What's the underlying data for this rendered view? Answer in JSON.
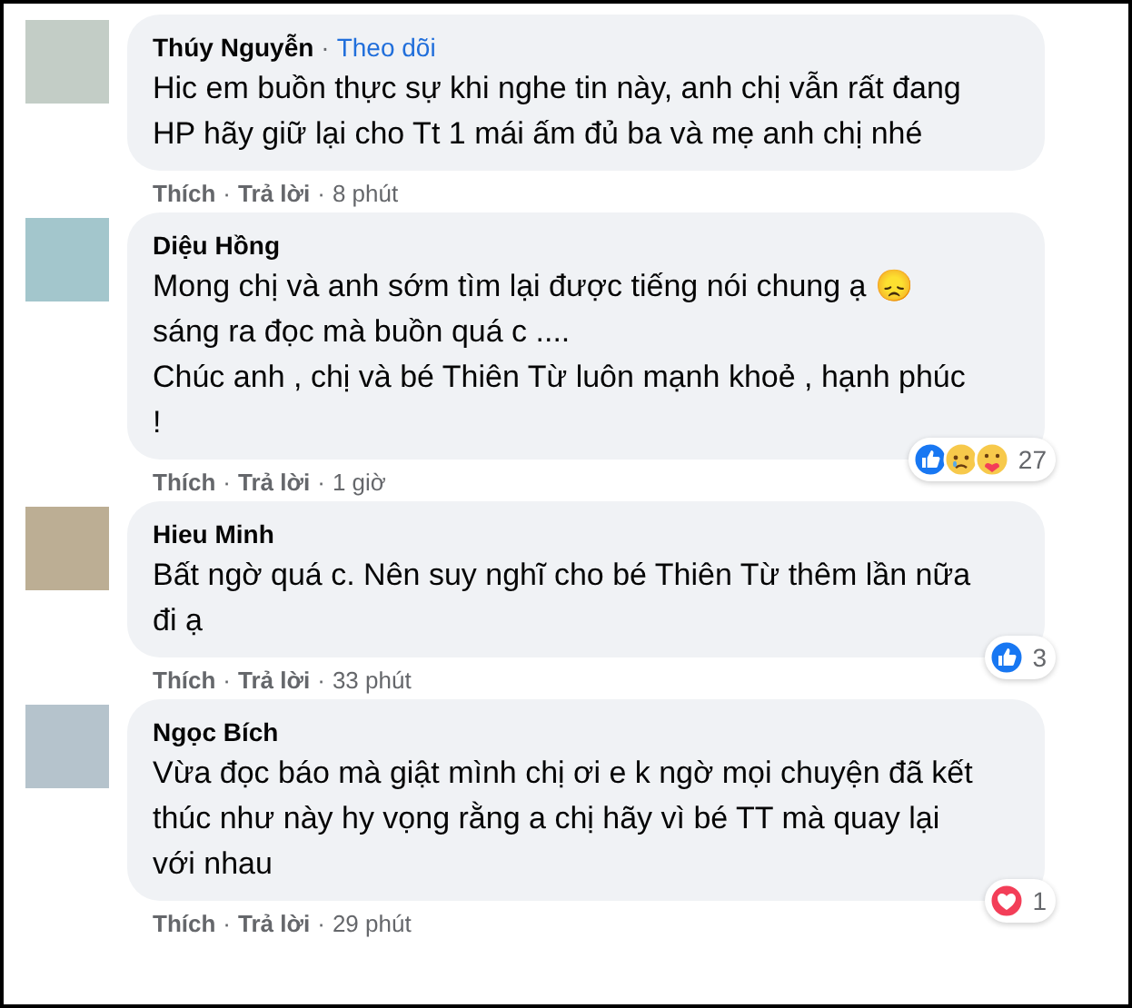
{
  "comments": [
    {
      "author": "Thúy Nguyễn",
      "separator": "·",
      "follow": "Theo dõi",
      "text": "Hic em buồn thực sự khi nghe tin này, anh chị vẫn rất đang HP hãy giữ lại cho Tt 1 mái ấm đủ ba và mẹ anh chị nhé",
      "actions": [
        "Thích",
        "Trả lời"
      ],
      "time": "8 phút"
    },
    {
      "author": "Diệu Hồng",
      "separator": "·",
      "text": "Mong chị và anh sớm tìm lại được tiếng nói chung ạ 😞\nsáng ra đọc mà buồn quá c ....\nChúc anh , chị và bé Thiên Từ luôn mạnh khoẻ , hạnh phúc !",
      "actions": [
        "Thích",
        "Trả lời"
      ],
      "time": "1 giờ",
      "reactions": {
        "icons": [
          {
            "kind": "like"
          },
          {
            "kind": "sad"
          },
          {
            "kind": "care"
          }
        ],
        "count": "27"
      }
    },
    {
      "author": "Hieu Minh",
      "separator": "·",
      "text": "Bất ngờ quá c. Nên suy nghĩ cho bé Thiên Từ thêm lần nữa đi ạ",
      "actions": [
        "Thích",
        "Trả lời"
      ],
      "time": "33 phút",
      "reactions": {
        "icons": [
          {
            "kind": "like"
          }
        ],
        "count": "3"
      }
    },
    {
      "author": "Ngọc Bích",
      "separator": "·",
      "text": "Vừa đọc báo mà giật mình chị ơi e k ngờ mọi chuyện đã kết thúc như này hy vọng rằng a chị hãy vì bé TT mà quay lại với nhau",
      "actions": [
        "Thích",
        "Trả lời"
      ],
      "time": "29 phút",
      "reactions": {
        "icons": [
          {
            "kind": "love"
          }
        ],
        "count": "1"
      }
    }
  ]
}
